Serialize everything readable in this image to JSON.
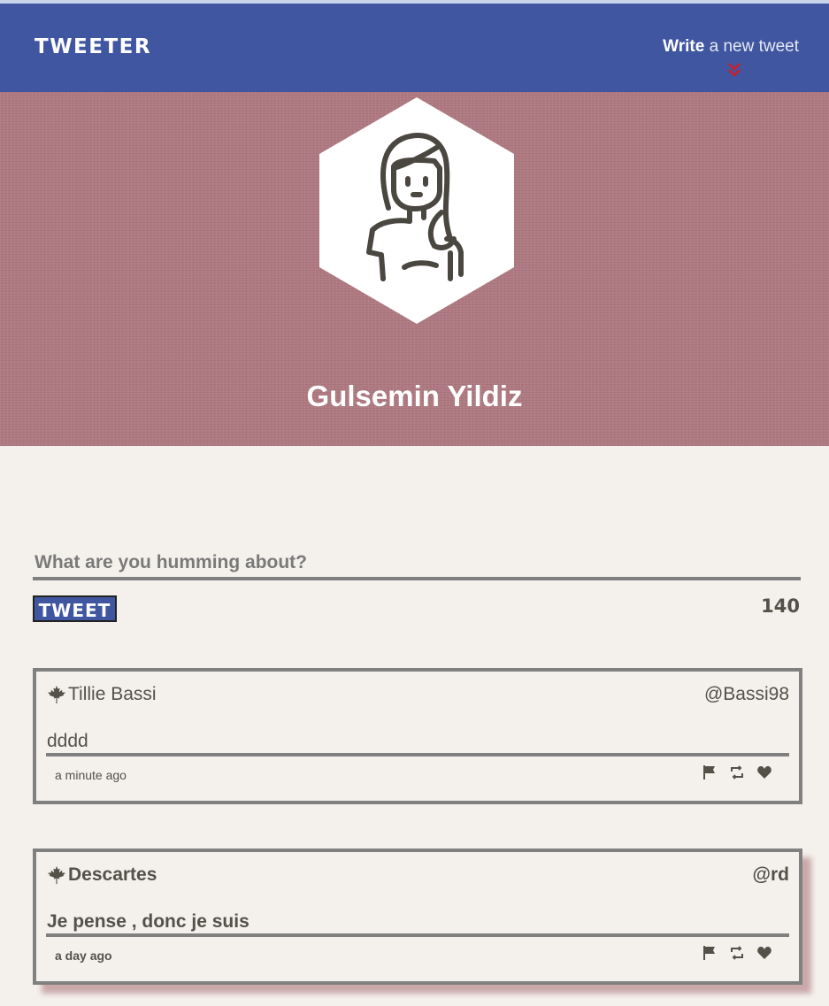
{
  "nav": {
    "brand": "TWEETER",
    "write_bold": "Write",
    "write_rest": "a new tweet",
    "accent_color": "#4056a1"
  },
  "profile": {
    "name": "Gulsemin Yildiz",
    "avatar_icon": "woman-avatar-icon",
    "hero_color": "#b07a82"
  },
  "compose": {
    "placeholder": "What are you humming about?",
    "button_label": "TWEET",
    "counter": "140"
  },
  "tweets": [
    {
      "author": "Tillie Bassi",
      "handle": "@Bassi98",
      "content": "dddd",
      "time": "a minute ago"
    },
    {
      "author": "Descartes",
      "handle": "@rd",
      "content": "Je pense , donc je suis",
      "time": "a day ago"
    }
  ],
  "icons": {
    "author_icon": "maple-leaf-icon",
    "actions": [
      "flag-icon",
      "retweet-icon",
      "heart-icon"
    ],
    "write_icon": "double-chevron-down-icon",
    "chevron_color": "#cc1e2a"
  }
}
